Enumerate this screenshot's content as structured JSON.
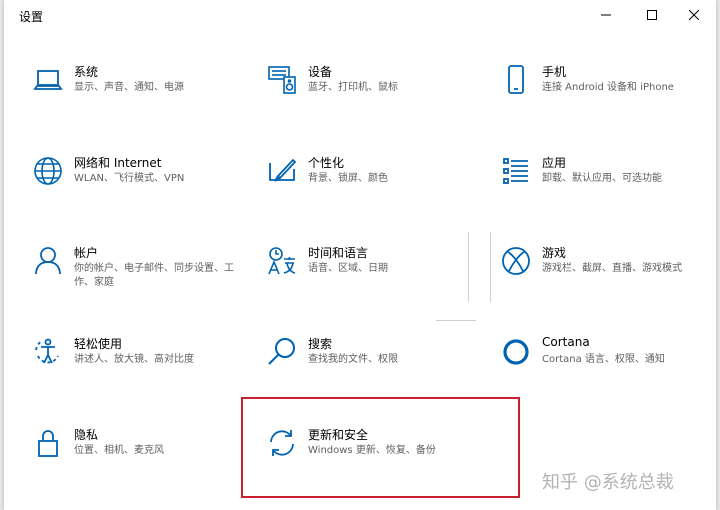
{
  "window": {
    "title": "设置"
  },
  "tiles": [
    {
      "name": "system",
      "label": "系统",
      "desc": "显示、声音、通知、电源",
      "icon": "laptop-icon"
    },
    {
      "name": "devices",
      "label": "设备",
      "desc": "蓝牙、打印机、鼠标",
      "icon": "keyboard-speaker-icon"
    },
    {
      "name": "phone",
      "label": "手机",
      "desc": "连接 Android 设备和 iPhone",
      "icon": "phone-icon"
    },
    {
      "name": "network",
      "label": "网络和 Internet",
      "desc": "WLAN、飞行模式、VPN",
      "icon": "globe-icon"
    },
    {
      "name": "personalization",
      "label": "个性化",
      "desc": "背景、锁屏、颜色",
      "icon": "brush-monitor-icon"
    },
    {
      "name": "apps",
      "label": "应用",
      "desc": "卸载、默认应用、可选功能",
      "icon": "app-list-icon"
    },
    {
      "name": "accounts",
      "label": "帐户",
      "desc": "你的帐户、电子邮件、同步设置、工作、家庭",
      "icon": "person-icon"
    },
    {
      "name": "time-language",
      "label": "时间和语言",
      "desc": "语音、区域、日期",
      "icon": "language-icon"
    },
    {
      "name": "gaming",
      "label": "游戏",
      "desc": "游戏栏、截屏、直播、游戏模式",
      "icon": "xbox-icon"
    },
    {
      "name": "ease-of-access",
      "label": "轻松使用",
      "desc": "讲述人、放大镜、高对比度",
      "icon": "ease-of-access-icon"
    },
    {
      "name": "search",
      "label": "搜索",
      "desc": "查找我的文件、权限",
      "icon": "search-icon"
    },
    {
      "name": "cortana",
      "label": "Cortana",
      "desc": "Cortana 语言、权限、通知",
      "icon": "cortana-icon"
    },
    {
      "name": "privacy",
      "label": "隐私",
      "desc": "位置、相机、麦克风",
      "icon": "lock-icon"
    },
    {
      "name": "update-security",
      "label": "更新和安全",
      "desc": "Windows 更新、恢复、备份",
      "icon": "sync-icon"
    }
  ],
  "watermark": {
    "text": "知乎 @系统总裁"
  },
  "colors": {
    "accent": "#0063b1",
    "highlight": "#c8202c"
  }
}
